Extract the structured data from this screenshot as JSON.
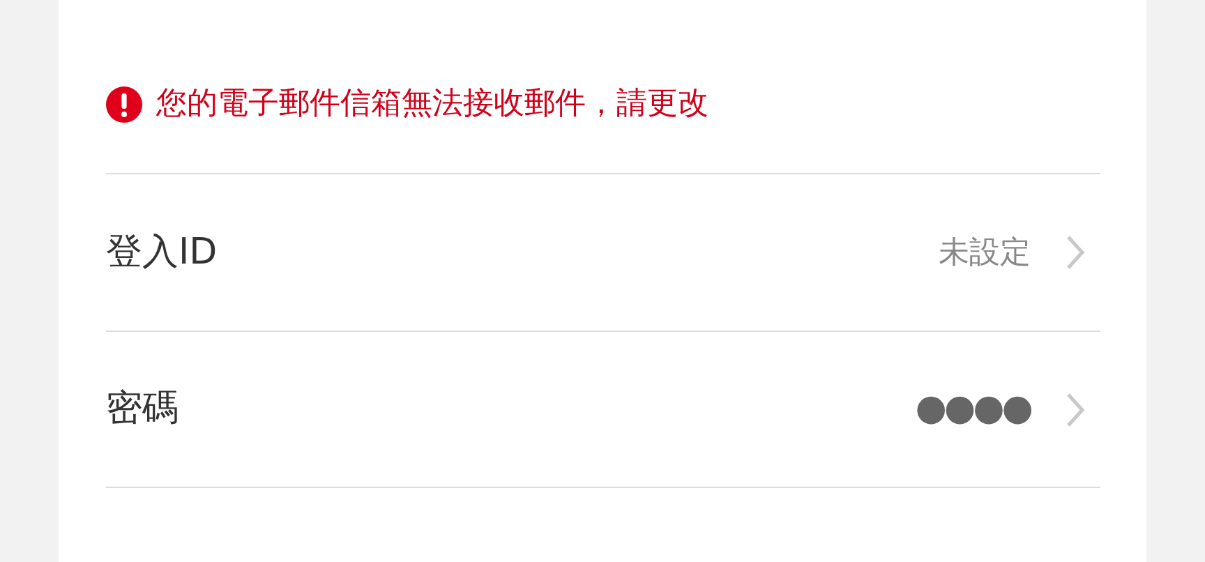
{
  "error": {
    "message": "您的電子郵件信箱無法接收郵件，請更改"
  },
  "rows": [
    {
      "label": "登入ID",
      "value": "未設定",
      "kind": "text"
    },
    {
      "label": "密碼",
      "value": "●●●●",
      "kind": "masked"
    }
  ]
}
